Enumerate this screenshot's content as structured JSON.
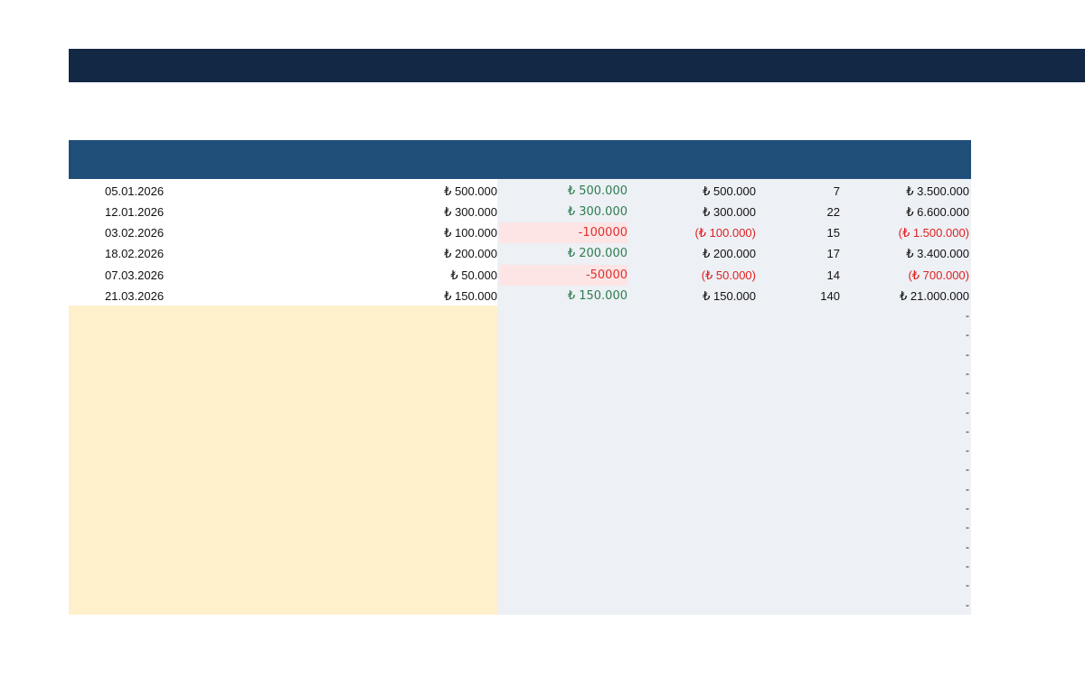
{
  "rows": [
    {
      "date": "05.01.2026",
      "amount": "₺ 500.000",
      "pl": "₺ 500.000",
      "pl_neg": false,
      "value": "₺ 500.000",
      "value_neg": false,
      "qty": "7",
      "total": "₺ 3.500.000",
      "total_neg": false
    },
    {
      "date": "12.01.2026",
      "amount": "₺ 300.000",
      "pl": "₺ 300.000",
      "pl_neg": false,
      "value": "₺ 300.000",
      "value_neg": false,
      "qty": "22",
      "total": "₺ 6.600.000",
      "total_neg": false
    },
    {
      "date": "03.02.2026",
      "amount": "₺ 100.000",
      "pl": "-100000",
      "pl_neg": true,
      "value": "(₺ 100.000)",
      "value_neg": true,
      "qty": "15",
      "total": "(₺ 1.500.000)",
      "total_neg": true
    },
    {
      "date": "18.02.2026",
      "amount": "₺ 200.000",
      "pl": "₺ 200.000",
      "pl_neg": false,
      "value": "₺ 200.000",
      "value_neg": false,
      "qty": "17",
      "total": "₺ 3.400.000",
      "total_neg": false
    },
    {
      "date": "07.03.2026",
      "amount": "₺ 50.000",
      "pl": "-50000",
      "pl_neg": true,
      "value": "(₺ 50.000)",
      "value_neg": true,
      "qty": "14",
      "total": "(₺ 700.000)",
      "total_neg": true
    },
    {
      "date": "21.03.2026",
      "amount": "₺ 150.000",
      "pl": "₺ 150.000",
      "pl_neg": false,
      "value": "₺ 150.000",
      "value_neg": false,
      "qty": "140",
      "total": "₺ 21.000.000",
      "total_neg": false
    }
  ],
  "empty_totals": [
    "-",
    "-",
    "-",
    "-",
    "-",
    "-",
    "-",
    "-",
    "-",
    "-",
    "-",
    "-",
    "-",
    "-",
    "-",
    "-"
  ],
  "colors": {
    "title_bar": "#132845",
    "table_header": "#1f4e79",
    "input_area": "#fff0cc",
    "calc_area": "#edf0f5",
    "positive": "#2e7d4f",
    "negative": "#e02020",
    "negative_fill": "#fde5e5"
  }
}
